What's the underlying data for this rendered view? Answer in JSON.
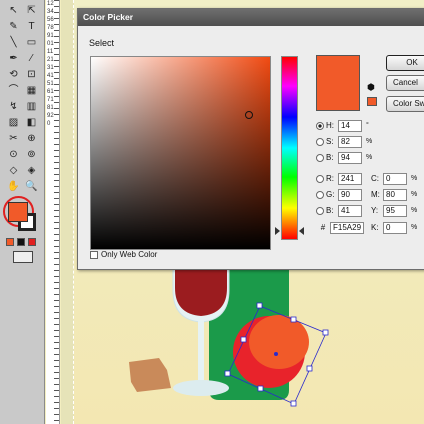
{
  "toolbox": {
    "tools": [
      "↖",
      "⇱",
      "✎",
      "T",
      "╲",
      "▭",
      "✒",
      "⁄",
      "⟲",
      "⊡",
      "⌒",
      "▦",
      "↯",
      "▥",
      "▨",
      "◧",
      "✂",
      "⊕",
      "⊙",
      "⊚",
      "◇",
      "◈",
      "✋",
      "🔍"
    ],
    "fill_color": "#f15a29",
    "mini_swatches": [
      "#f15a29",
      "#111111",
      "#e02020"
    ]
  },
  "ruler": {
    "numbers": "1234567891011121314151617181920"
  },
  "dialog": {
    "title": "Color Picker",
    "select_label": "Select",
    "new_color": "#f15a29",
    "buttons": {
      "ok": "OK",
      "cancel": "Cancel",
      "swatches": "Color Swatches"
    },
    "hsb": [
      {
        "label": "H:",
        "value": "14",
        "unit": "°",
        "selected": true
      },
      {
        "label": "S:",
        "value": "82",
        "unit": "%",
        "selected": false
      },
      {
        "label": "B:",
        "value": "94",
        "unit": "%",
        "selected": false
      }
    ],
    "rgb": [
      {
        "label": "R:",
        "value": "241"
      },
      {
        "label": "G:",
        "value": "90"
      },
      {
        "label": "B:",
        "value": "41"
      }
    ],
    "cmyk": [
      {
        "label": "C:",
        "value": "0",
        "unit": "%"
      },
      {
        "label": "M:",
        "value": "80",
        "unit": "%"
      },
      {
        "label": "Y:",
        "value": "95",
        "unit": "%"
      },
      {
        "label": "K:",
        "value": "0",
        "unit": "%"
      }
    ],
    "hex_label": "#",
    "hex_value": "F15A29",
    "only_web_label": "Only Web Color"
  },
  "colors": {
    "accent": "#f15a29",
    "bottle": "#1b9a4a",
    "wine": "#9b1c1f",
    "cork": "#c98a5a"
  }
}
